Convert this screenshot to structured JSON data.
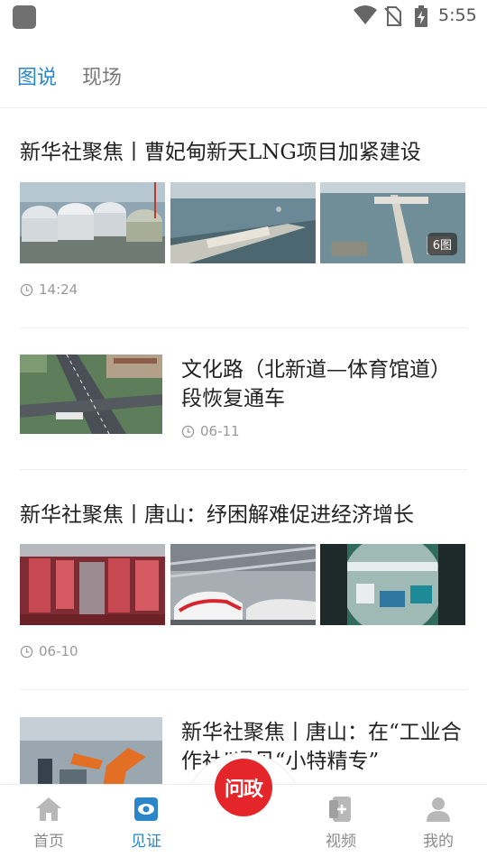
{
  "status_bar": {
    "time": "5:55",
    "icons": [
      "app-icon",
      "wifi-icon",
      "no-sim-icon",
      "battery-charging-icon"
    ]
  },
  "tabs": [
    {
      "label": "图说",
      "active": true
    },
    {
      "label": "现场",
      "active": false
    }
  ],
  "feed": [
    {
      "layout": "three-image",
      "title": "新华社聚焦丨曹妃甸新天LNG项目加紧建设",
      "image_count_badge": "6图",
      "time": "14:24"
    },
    {
      "layout": "side-image",
      "title": "文化路（北新道—体育馆道）段恢复通车",
      "time": "06-11"
    },
    {
      "layout": "three-image",
      "title": "新华社聚焦丨唐山：纾困解难促进经济增长",
      "time": "06-10"
    },
    {
      "layout": "side-image",
      "title": "新华社聚焦丨唐山：在“工业合作社”遇见“小特精专”"
    }
  ],
  "bottom_nav": {
    "items": [
      {
        "label": "首页",
        "icon": "home-icon",
        "active": false
      },
      {
        "label": "见证",
        "icon": "eye-icon",
        "active": true
      },
      {
        "label": "视频",
        "icon": "video-add-icon",
        "active": false
      },
      {
        "label": "我的",
        "icon": "profile-icon",
        "active": false
      }
    ],
    "center_logo_text": "问政",
    "accent_color": "#2a86c8",
    "logo_color": "#e4262b"
  }
}
